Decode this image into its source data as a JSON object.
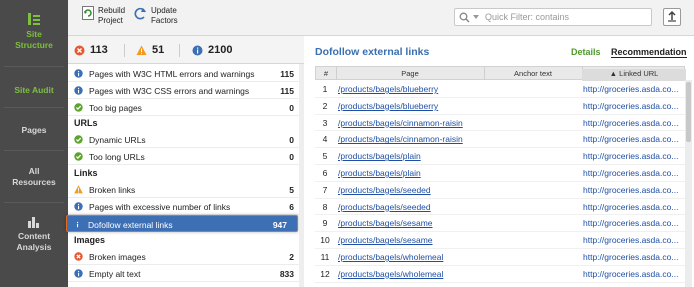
{
  "sidebar": {
    "items": [
      {
        "label_1": "Site",
        "label_2": "Structure",
        "icon": "site-structure-icon",
        "active": true
      },
      {
        "label_1": "Site Audit",
        "label_2": "",
        "icon": "",
        "active": true
      },
      {
        "label_1": "Pages",
        "label_2": "",
        "icon": ""
      },
      {
        "label_1": "All",
        "label_2": "Resources",
        "icon": ""
      },
      {
        "label_1": "Content",
        "label_2": "Analysis",
        "icon": "content-analysis-icon"
      }
    ]
  },
  "toolbar": {
    "rebuild_label_1": "Rebuild",
    "rebuild_label_2": "Project",
    "update_label_1": "Update",
    "update_label_2": "Factors",
    "filter_placeholder": "Quick Filter: contains"
  },
  "counts": {
    "errors": "113",
    "warnings": "51",
    "info": "2100"
  },
  "issues": {
    "group_top": [
      {
        "status": "info",
        "label": "Pages with W3C HTML errors and warnings",
        "value": "115"
      },
      {
        "status": "info",
        "label": "Pages with W3C CSS errors and warnings",
        "value": "115"
      },
      {
        "status": "ok",
        "label": "Too big pages",
        "value": "0"
      }
    ],
    "urls_header": "URLs",
    "urls": [
      {
        "status": "ok",
        "label": "Dynamic URLs",
        "value": "0"
      },
      {
        "status": "ok",
        "label": "Too long URLs",
        "value": "0"
      }
    ],
    "links_header": "Links",
    "links": [
      {
        "status": "warning",
        "label": "Broken links",
        "value": "5"
      },
      {
        "status": "info",
        "label": "Pages with excessive number of links",
        "value": "6"
      },
      {
        "status": "info",
        "label": "Dofollow external links",
        "value": "947",
        "selected": true
      }
    ],
    "images_header": "Images",
    "images": [
      {
        "status": "error",
        "label": "Broken images",
        "value": "2"
      },
      {
        "status": "info",
        "label": "Empty alt text",
        "value": "833"
      }
    ]
  },
  "detail": {
    "title": "Dofollow external links",
    "tab_details": "Details",
    "tab_recommendation": "Recommendation",
    "columns": [
      "#",
      "Page",
      "Anchor text",
      "Linked URL"
    ],
    "rows": [
      {
        "n": "1",
        "page": "/products/bagels/blueberry",
        "anchor": "",
        "url": "http://groceries.asda.co..."
      },
      {
        "n": "2",
        "page": "/products/bagels/blueberry",
        "anchor": "",
        "url": "http://groceries.asda.co..."
      },
      {
        "n": "3",
        "page": "/products/bagels/cinnamon-raisin",
        "anchor": "",
        "url": "http://groceries.asda.co..."
      },
      {
        "n": "4",
        "page": "/products/bagels/cinnamon-raisin",
        "anchor": "",
        "url": "http://groceries.asda.co..."
      },
      {
        "n": "5",
        "page": "/products/bagels/plain",
        "anchor": "",
        "url": "http://groceries.asda.co..."
      },
      {
        "n": "6",
        "page": "/products/bagels/plain",
        "anchor": "",
        "url": "http://groceries.asda.co..."
      },
      {
        "n": "7",
        "page": "/products/bagels/seeded",
        "anchor": "",
        "url": "http://groceries.asda.co..."
      },
      {
        "n": "8",
        "page": "/products/bagels/seeded",
        "anchor": "",
        "url": "http://groceries.asda.co..."
      },
      {
        "n": "9",
        "page": "/products/bagels/sesame",
        "anchor": "",
        "url": "http://groceries.asda.co..."
      },
      {
        "n": "10",
        "page": "/products/bagels/sesame",
        "anchor": "",
        "url": "http://groceries.asda.co..."
      },
      {
        "n": "11",
        "page": "/products/bagels/wholemeal",
        "anchor": "",
        "url": "http://groceries.asda.co..."
      },
      {
        "n": "12",
        "page": "/products/bagels/wholemeal",
        "anchor": "",
        "url": "http://groceries.asda.co..."
      }
    ]
  },
  "colors": {
    "accent": "#3d6fb5",
    "active_green": "#7fbf3f",
    "error": "#e8572f",
    "warning": "#f39a1e",
    "info": "#3b6fb6",
    "ok": "#5aa52a"
  }
}
